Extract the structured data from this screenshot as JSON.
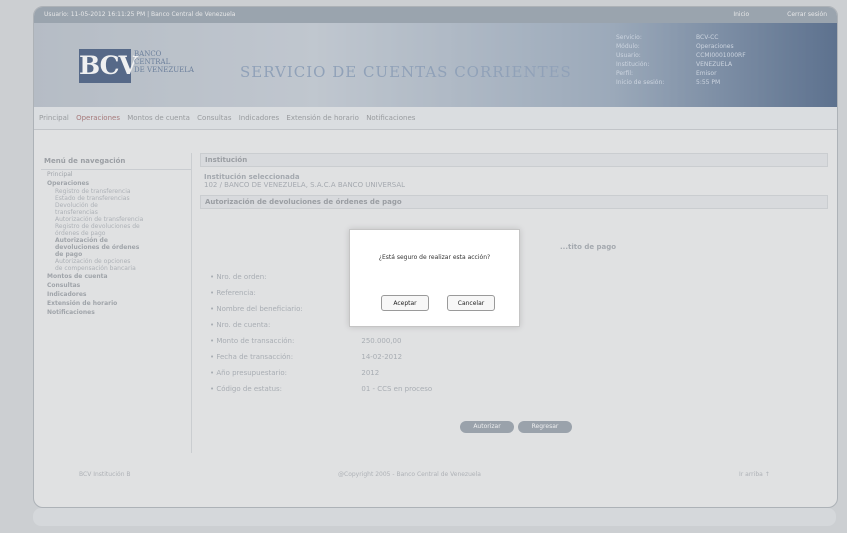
{
  "topbar": {
    "left_text": "Usuario: 11-05-2012 16:11:25 PM  |  Banco Central de Venezuela",
    "right_user": "Inicio",
    "right_exit": "Cerrar sesión"
  },
  "brand": {
    "logo": "BCV",
    "bank_lines": [
      "BANCO",
      "CENTRAL",
      "DE VENEZUELA"
    ],
    "service_title": "SERVICIO DE CUENTAS CORRIENTES"
  },
  "user_info": [
    {
      "k": "Servicio:",
      "v": "BCV-CC"
    },
    {
      "k": "Módulo:",
      "v": "Operaciones"
    },
    {
      "k": "Usuario:",
      "v": "CCMI0001000RF"
    },
    {
      "k": "Institución:",
      "v": "VENEZUELA"
    },
    {
      "k": "Perfil:",
      "v": "Emisor"
    },
    {
      "k": "Inicio de sesión:",
      "v": "5:55 PM"
    }
  ],
  "menu": {
    "items": [
      "Principal",
      "Operaciones",
      "Montos de cuenta",
      "Consultas",
      "Indicadores",
      "Extensión de horario",
      "Notificaciones"
    ],
    "active_index": 1
  },
  "sidebar": {
    "title": "Menú de navegación",
    "items": [
      {
        "label": "Principal",
        "level": 0,
        "bold": false
      },
      {
        "label": "Operaciones",
        "level": 0,
        "bold": true
      },
      {
        "label": "Registro de transferencia",
        "level": 1,
        "bold": false
      },
      {
        "label": "Estado de transferencias",
        "level": 1,
        "bold": false
      },
      {
        "label": "Devolución de",
        "level": 1,
        "bold": false
      },
      {
        "label": "transferencias",
        "level": 1,
        "bold": false
      },
      {
        "label": "Autorización de transferencia",
        "level": 1,
        "bold": false
      },
      {
        "label": "Registro de devoluciones de",
        "level": 1,
        "bold": false
      },
      {
        "label": "órdenes de pago",
        "level": 1,
        "bold": false
      },
      {
        "label": "Autorización de",
        "level": 1,
        "bold": true
      },
      {
        "label": "devoluciones de órdenes",
        "level": 1,
        "bold": true
      },
      {
        "label": "de pago",
        "level": 1,
        "bold": true
      },
      {
        "label": "Autorización de opciones",
        "level": 1,
        "bold": false
      },
      {
        "label": "de compensación bancaria",
        "level": 1,
        "bold": false
      },
      {
        "label": "Montos de cuenta",
        "level": 0,
        "bold": true
      },
      {
        "label": "Consultas",
        "level": 0,
        "bold": true
      },
      {
        "label": "Indicadores",
        "level": 0,
        "bold": true
      },
      {
        "label": "Extensión de horario",
        "level": 0,
        "bold": true
      },
      {
        "label": "Notificaciones",
        "level": 0,
        "bold": true
      }
    ]
  },
  "content": {
    "section1_title": "Institución",
    "section1_label": "Institución seleccionada",
    "section1_value": "102 / BANCO DE VENEZUELA, S.A.C.A BANCO UNIVERSAL",
    "section2_title": "Autorización de devoluciones de órdenes de pago",
    "section2_sub": "...tito de pago",
    "rows": [
      {
        "label": "Nro. de orden:",
        "value": ""
      },
      {
        "label": "Referencia:",
        "value": ""
      },
      {
        "label": "Nombre del beneficiario:",
        "value": ""
      },
      {
        "label": "Nro. de cuenta:",
        "value": ""
      },
      {
        "label": "Monto de transacción:",
        "value": "250.000,00"
      },
      {
        "label": "Fecha de transacción:",
        "value": "14-02-2012"
      },
      {
        "label": "Año presupuestario:",
        "value": "2012"
      },
      {
        "label": "Código de estatus:",
        "value": "01 - CCS en proceso"
      }
    ],
    "btn_authorize": "Autorizar",
    "btn_back": "Regresar"
  },
  "footer": {
    "left": "BCV  Institución B",
    "center": "@Copyright 2005 - Banco Central de Venezuela",
    "right": "Ir arriba"
  },
  "modal": {
    "message": "¿Está seguro de realizar esta acción?",
    "ok": "Aceptar",
    "cancel": "Cancelar"
  },
  "colors": {
    "accent": "#8f4a4a",
    "brand_blue": "#15315e"
  }
}
